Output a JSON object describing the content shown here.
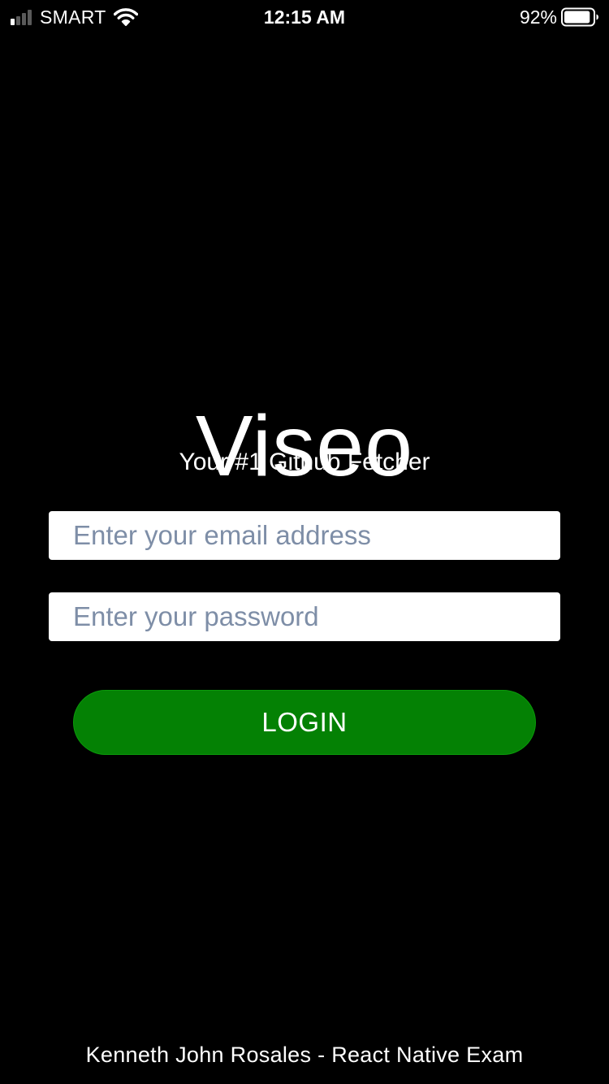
{
  "status_bar": {
    "carrier": "SMART",
    "time": "12:15 AM",
    "battery_percent": "92%",
    "battery_level": 0.92,
    "signal_bars_active": 1,
    "signal_bars_total": 4,
    "icons": [
      "signal-icon",
      "wifi-icon",
      "battery-icon"
    ]
  },
  "app": {
    "title": "Viseo",
    "subtitle": "Your #1 Github Fetcher"
  },
  "form": {
    "email": {
      "value": "",
      "placeholder": "Enter your email address"
    },
    "password": {
      "value": "",
      "placeholder": "Enter your password"
    },
    "login_label": "LOGIN"
  },
  "footer": {
    "credit": "Kenneth John Rosales - React Native Exam"
  },
  "colors": {
    "background": "#000000",
    "text": "#ffffff",
    "placeholder": "#7e8ea7",
    "input_background": "#ffffff",
    "button_background": "#048104"
  }
}
